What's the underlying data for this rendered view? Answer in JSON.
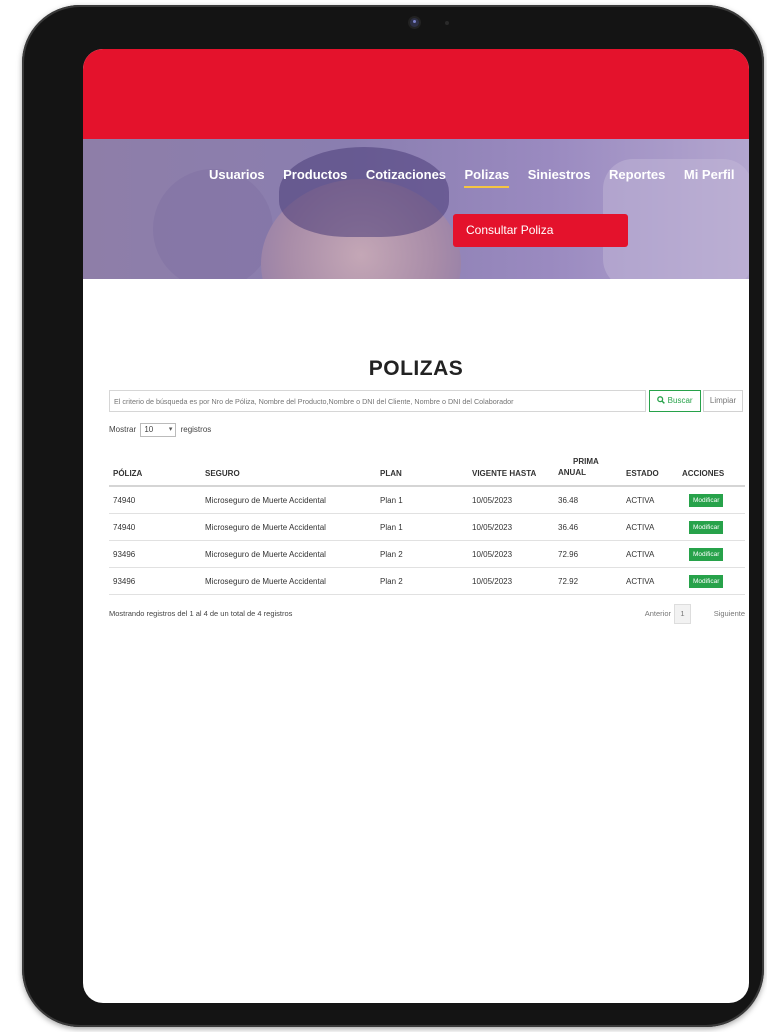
{
  "nav": {
    "items": [
      {
        "label": "Usuarios"
      },
      {
        "label": "Productos"
      },
      {
        "label": "Cotizaciones"
      },
      {
        "label": "Polizas",
        "active": true
      },
      {
        "label": "Siniestros"
      },
      {
        "label": "Reportes"
      },
      {
        "label": "Mi Perfil"
      }
    ],
    "active_color": "#f5c542"
  },
  "hero": {
    "button_label": "Consultar Poliza"
  },
  "page": {
    "title": "POLIZAS"
  },
  "search": {
    "placeholder": "El criterio de búsqueda es por Nro de Póliza, Nombre del Producto,Nombre o DNI del Cliente, Nombre o DNI del Colaborador",
    "buscar_label": "Buscar",
    "buscar_icon": "search-icon",
    "limpiar_label": "Limpiar"
  },
  "length": {
    "prefix": "Mostrar",
    "value": "10",
    "suffix": "registros"
  },
  "table": {
    "headers": {
      "poliza": "PÓLIZA",
      "seguro": "SEGURO",
      "plan": "PLAN",
      "vigente": "VIGENTE HASTA",
      "prima_line1": "PRIMA",
      "prima_line2": "ANUAL",
      "estado": "ESTADO",
      "acciones": "ACCIONES"
    },
    "rows": [
      {
        "poliza": "74940",
        "seguro": "Microseguro de Muerte Accidental",
        "plan": "Plan 1",
        "vigente": "10/05/2023",
        "prima": "36.48",
        "estado": "ACTIVA",
        "accion": "Modificar"
      },
      {
        "poliza": "74940",
        "seguro": "Microseguro de Muerte Accidental",
        "plan": "Plan 1",
        "vigente": "10/05/2023",
        "prima": "36.46",
        "estado": "ACTIVA",
        "accion": "Modificar"
      },
      {
        "poliza": "93496",
        "seguro": "Microseguro de Muerte Accidental",
        "plan": "Plan 2",
        "vigente": "10/05/2023",
        "prima": "72.96",
        "estado": "ACTIVA",
        "accion": "Modificar"
      },
      {
        "poliza": "93496",
        "seguro": "Microseguro de Muerte Accidental",
        "plan": "Plan 2",
        "vigente": "10/05/2023",
        "prima": "72.92",
        "estado": "ACTIVA",
        "accion": "Modificar"
      }
    ]
  },
  "footer": {
    "info": "Mostrando registros del 1 al 4 de un total de 4 registros",
    "prev": "Anterior",
    "page": "1",
    "next": "Siguiente"
  },
  "colors": {
    "brand_red": "#e4122c",
    "action_green": "#27a24a"
  }
}
